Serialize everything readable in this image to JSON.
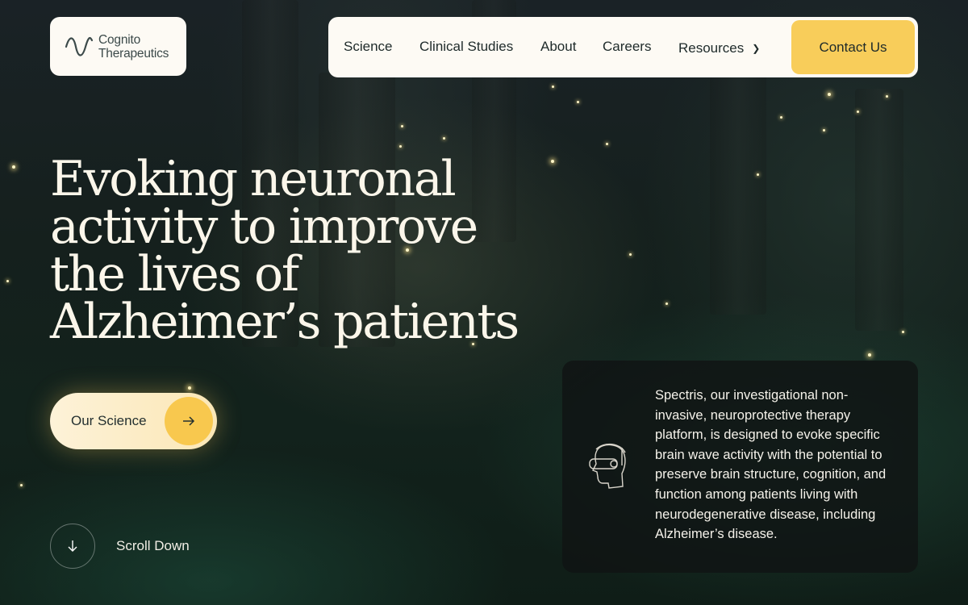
{
  "brand": {
    "name_line1": "Cognito",
    "name_line2": "Therapeutics",
    "logo_icon": "wave-logo-icon"
  },
  "nav": {
    "items": [
      {
        "label": "Science"
      },
      {
        "label": "Clinical Studies"
      },
      {
        "label": "About"
      },
      {
        "label": "Careers"
      },
      {
        "label": "Resources",
        "icon": "chevron-down-icon"
      }
    ],
    "cta": "Contact Us"
  },
  "hero": {
    "title_lines": [
      "Evoking neuronal",
      "activity to improve",
      "the lives of",
      "Alzheimer’s patients"
    ],
    "primary_button": "Our Science",
    "primary_button_icon": "arrow-right-icon",
    "scroll_label": "Scroll Down",
    "scroll_icon": "arrow-down-icon"
  },
  "info_card": {
    "icon": "head-with-headset-icon",
    "text": "Spectris, our investigational non-invasive, neuroprotective therapy platform, is designed to evoke specific brain wave activity with the potential to preserve brain structure, cognition, and function among patients living with neurodegenerative disease, including Alzheimer’s disease."
  },
  "colors": {
    "accent": "#f8cd5a",
    "card_bg": "#fdfaf4",
    "hero_text": "#fbf6ea",
    "background": "#12221c"
  }
}
